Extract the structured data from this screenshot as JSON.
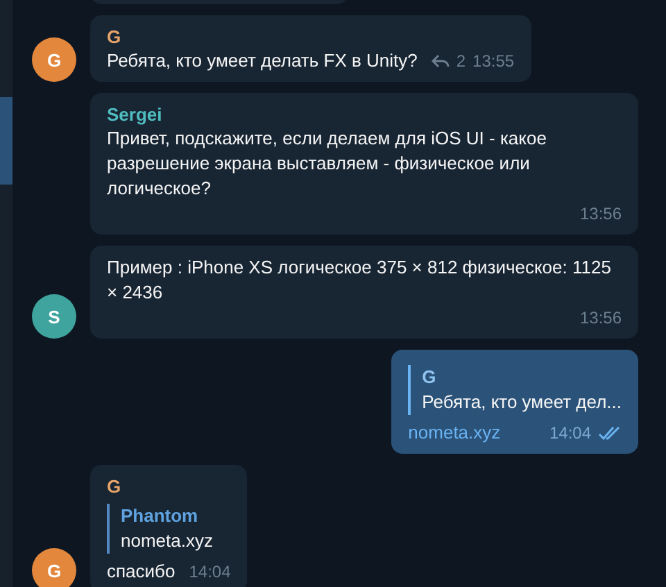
{
  "sidebar": {
    "items": [
      {
        "selected": false
      },
      {
        "selected": true
      },
      {
        "selected": false
      }
    ]
  },
  "messages": [
    {
      "kind": "fragment"
    },
    {
      "kind": "incoming",
      "sender": "G",
      "color": "#e6a46b",
      "avatar": {
        "letter": "G",
        "color": "#e3873d"
      },
      "text": "Ребята, кто умеет делать FX в Unity?",
      "replies": "2",
      "time": "13:55"
    },
    {
      "kind": "incoming",
      "sender": "Sergei",
      "color": "#4fbcc0",
      "text": "Привет, подскажите, если делаем для iOS UI - какое разрешение экрана выставляем - физическое или логическое?",
      "time": "13:56"
    },
    {
      "kind": "incoming",
      "avatar": {
        "letter": "S",
        "color": "#3fa39e"
      },
      "text": "Пример : iPhone XS логическое 375 × 812 физическое: 1125 × 2436",
      "time": "13:56"
    },
    {
      "kind": "outgoing",
      "quote": {
        "author": "G",
        "text": "Ребята, кто умеет дел..."
      },
      "text": "nometa.xyz",
      "link": true,
      "time": "14:04",
      "read": true
    },
    {
      "kind": "incoming",
      "sender": "G",
      "color": "#e6a46b",
      "avatar": {
        "letter": "G",
        "color": "#e3873d"
      },
      "quote": {
        "author": "Phantom",
        "text": "nometa.xyz"
      },
      "text": "спасибо",
      "time": "14:04"
    }
  ]
}
